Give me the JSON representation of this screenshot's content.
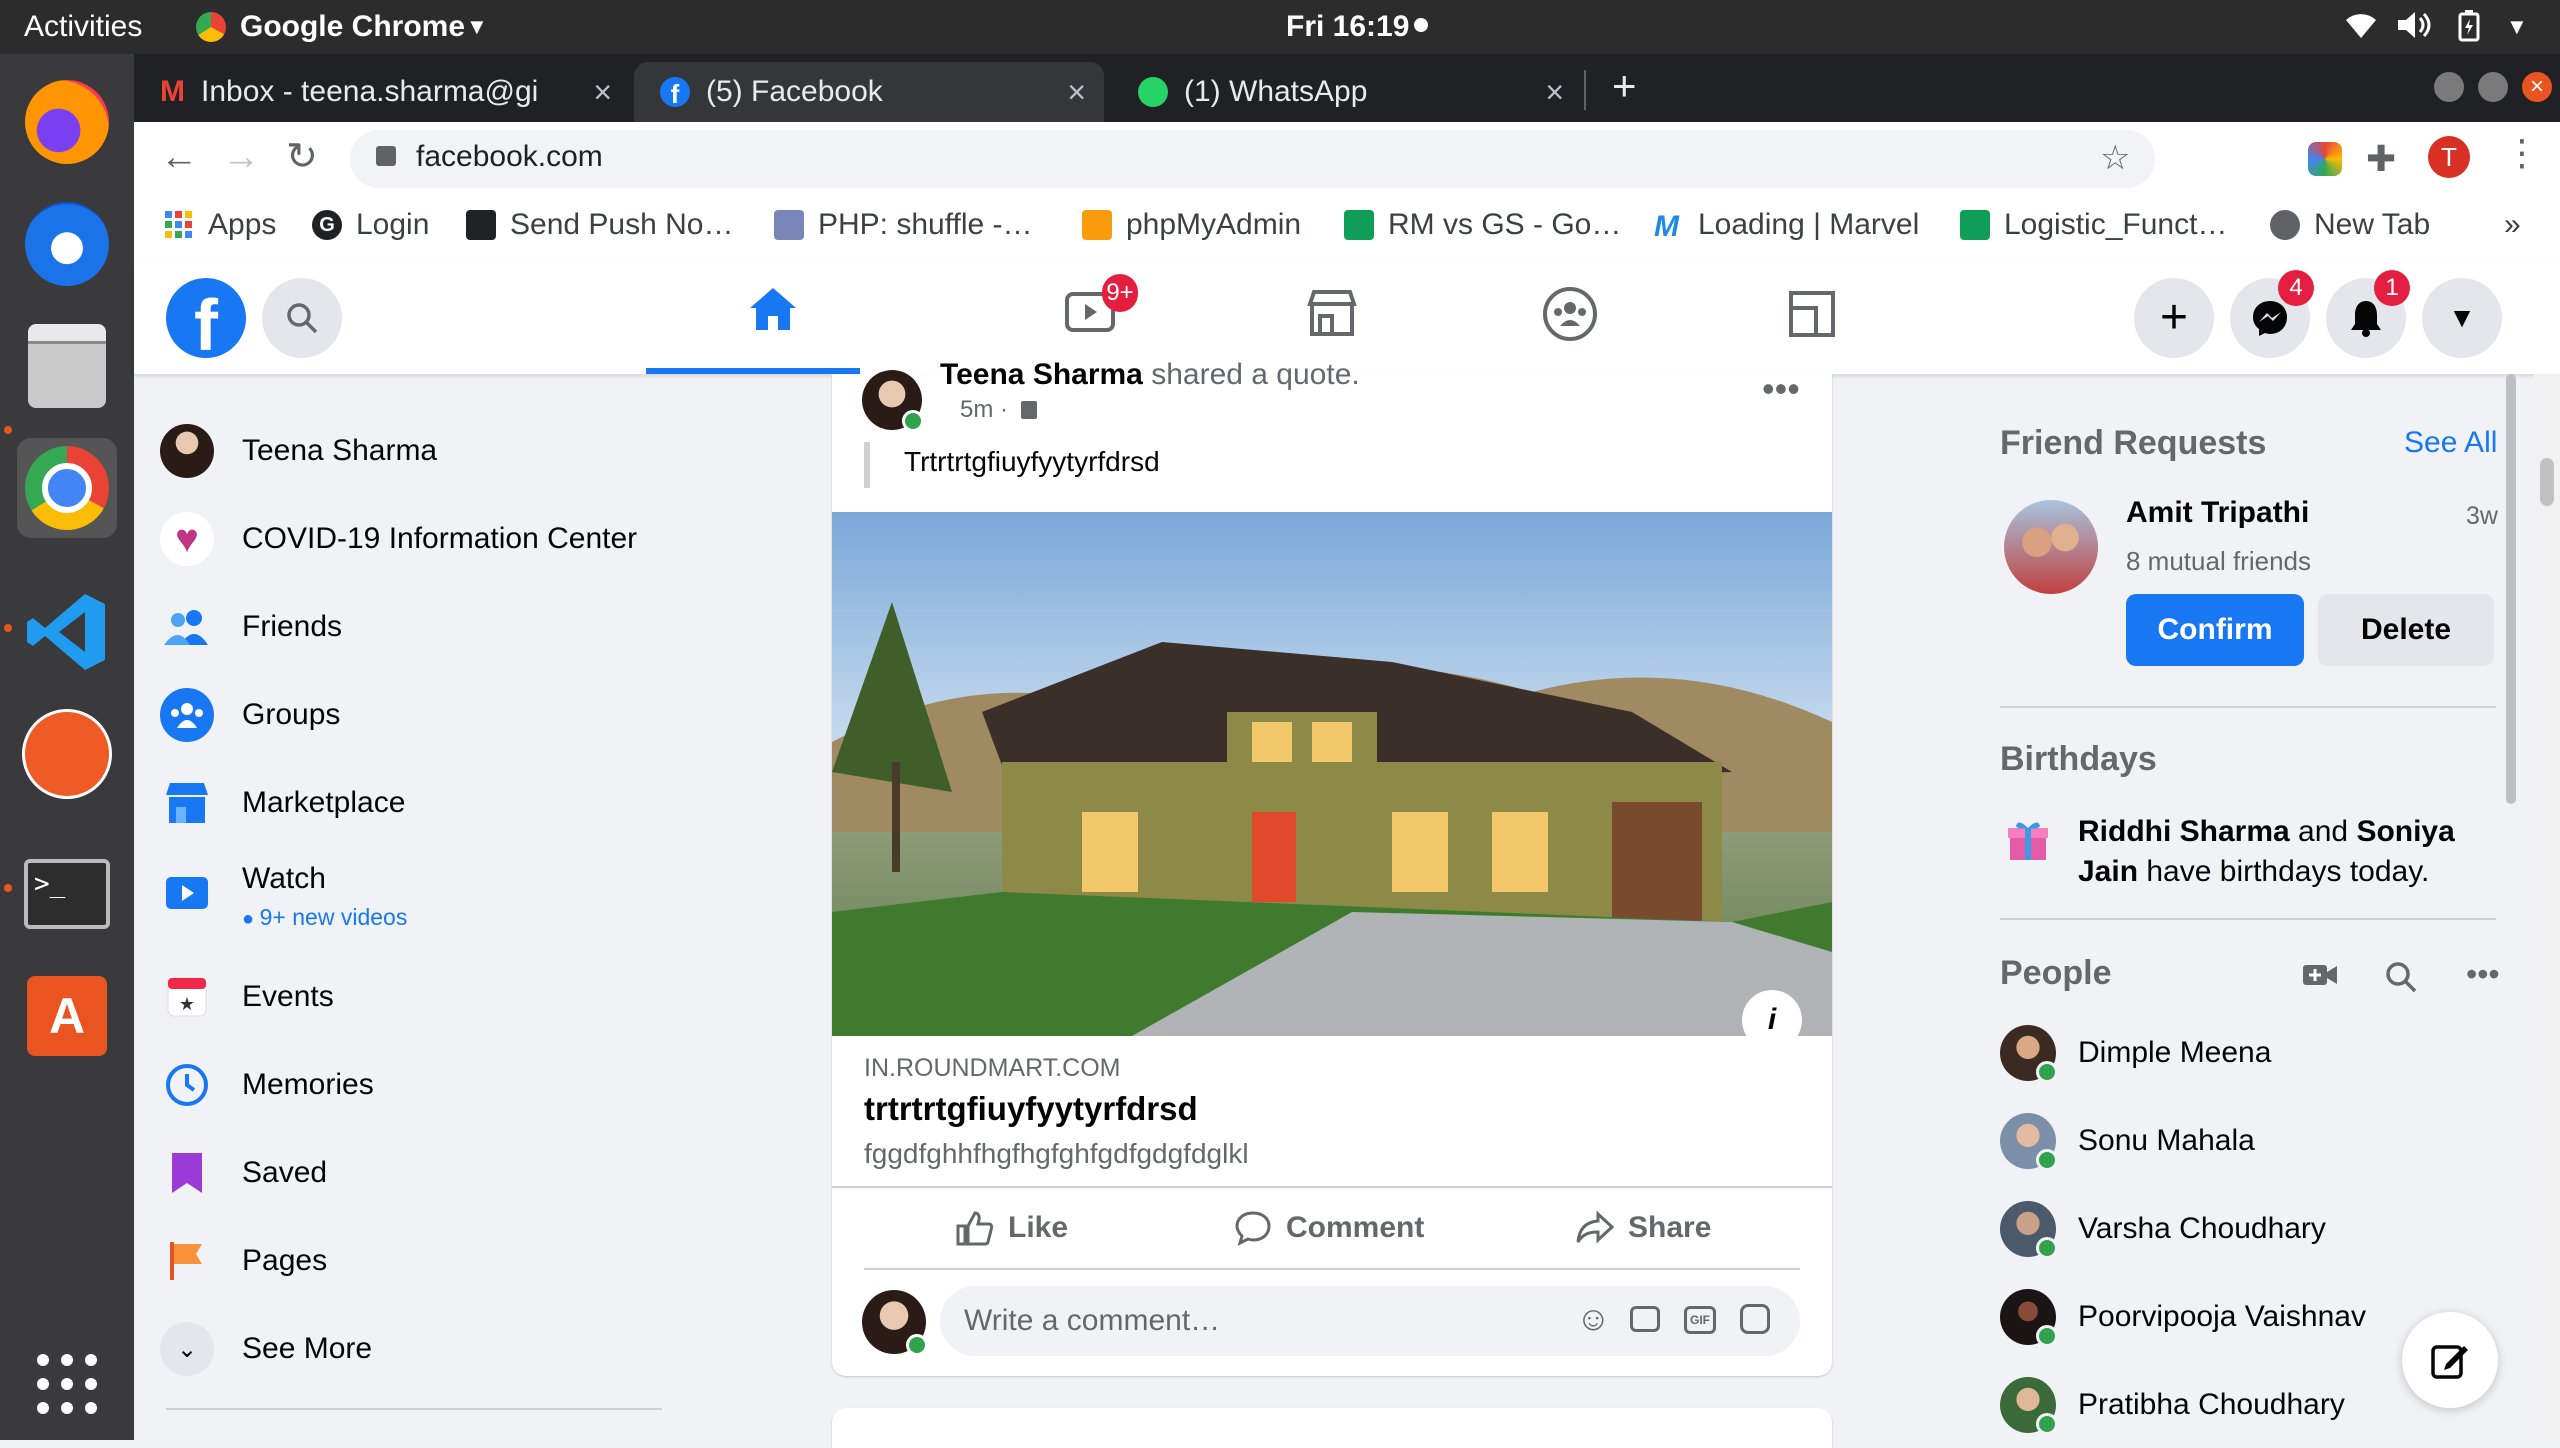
{
  "ubuntu": {
    "activities": "Activities",
    "app_name": "Google Chrome",
    "clock": "Fri 16:19"
  },
  "chrome": {
    "tabs": [
      {
        "title": "Inbox - teena.sharma@gi",
        "icon": "gmail-icon"
      },
      {
        "title": "(5) Facebook",
        "icon": "facebook-icon"
      },
      {
        "title": "(1) WhatsApp",
        "icon": "whatsapp-icon"
      }
    ],
    "url": "facebook.com",
    "profile_initial": "T",
    "bookmarks": [
      {
        "label": "Apps",
        "color": "#4285f4"
      },
      {
        "label": "Login",
        "color": "#202124"
      },
      {
        "label": "Send Push No…",
        "color": "#202124"
      },
      {
        "label": "PHP: shuffle -…",
        "color": "#7a86b8"
      },
      {
        "label": "phpMyAdmin",
        "color": "#f89c0e"
      },
      {
        "label": "RM vs GS - Go…",
        "color": "#0f9d58"
      },
      {
        "label": "Loading | Marvel",
        "color": "#1e88e5"
      },
      {
        "label": "Logistic_Funct…",
        "color": "#0f9d58"
      },
      {
        "label": "New Tab",
        "color": "#5f6368"
      }
    ],
    "overflow": "»"
  },
  "fb_header": {
    "watch_badge": "9+",
    "messenger_badge": "4",
    "notifications_badge": "1"
  },
  "sidebar": {
    "items": [
      {
        "label": "Teena Sharma"
      },
      {
        "label": "COVID-19 Information Center"
      },
      {
        "label": "Friends"
      },
      {
        "label": "Groups"
      },
      {
        "label": "Marketplace"
      },
      {
        "label": "Watch",
        "sub": "9+ new videos"
      },
      {
        "label": "Events"
      },
      {
        "label": "Memories"
      },
      {
        "label": "Saved"
      },
      {
        "label": "Pages"
      },
      {
        "label": "See More"
      }
    ]
  },
  "post": {
    "author": "Teena Sharma",
    "action": "shared a quote.",
    "time": "5m ·",
    "quote": "Trtrtrtgfiuyfyytyrfdrsd",
    "link_domain": "IN.ROUNDMART.COM",
    "link_title": "trtrtrtgfiuyfyytyrfdrsd",
    "link_desc": "fggdfghhfhgfhgfghfgdfgdgfdglkl",
    "like": "Like",
    "comment": "Comment",
    "share": "Share",
    "comment_placeholder": "Write a comment…"
  },
  "right": {
    "friend_requests_title": "Friend Requests",
    "see_all": "See All",
    "request": {
      "name": "Amit Tripathi",
      "time": "3w",
      "mutual": "8 mutual friends",
      "confirm": "Confirm",
      "delete": "Delete"
    },
    "birthdays_title": "Birthdays",
    "birthday_name1": "Riddhi Sharma",
    "birthday_and": " and ",
    "birthday_name2": "Soniya",
    "birthday_name2b": "Jain",
    "birthday_rest": " have birthdays today.",
    "people_title": "People",
    "people": [
      {
        "name": "Dimple Meena"
      },
      {
        "name": "Sonu Mahala"
      },
      {
        "name": "Varsha Choudhary"
      },
      {
        "name": "Poorvipooja Vaishnav"
      },
      {
        "name": "Pratibha Choudhary"
      }
    ]
  }
}
